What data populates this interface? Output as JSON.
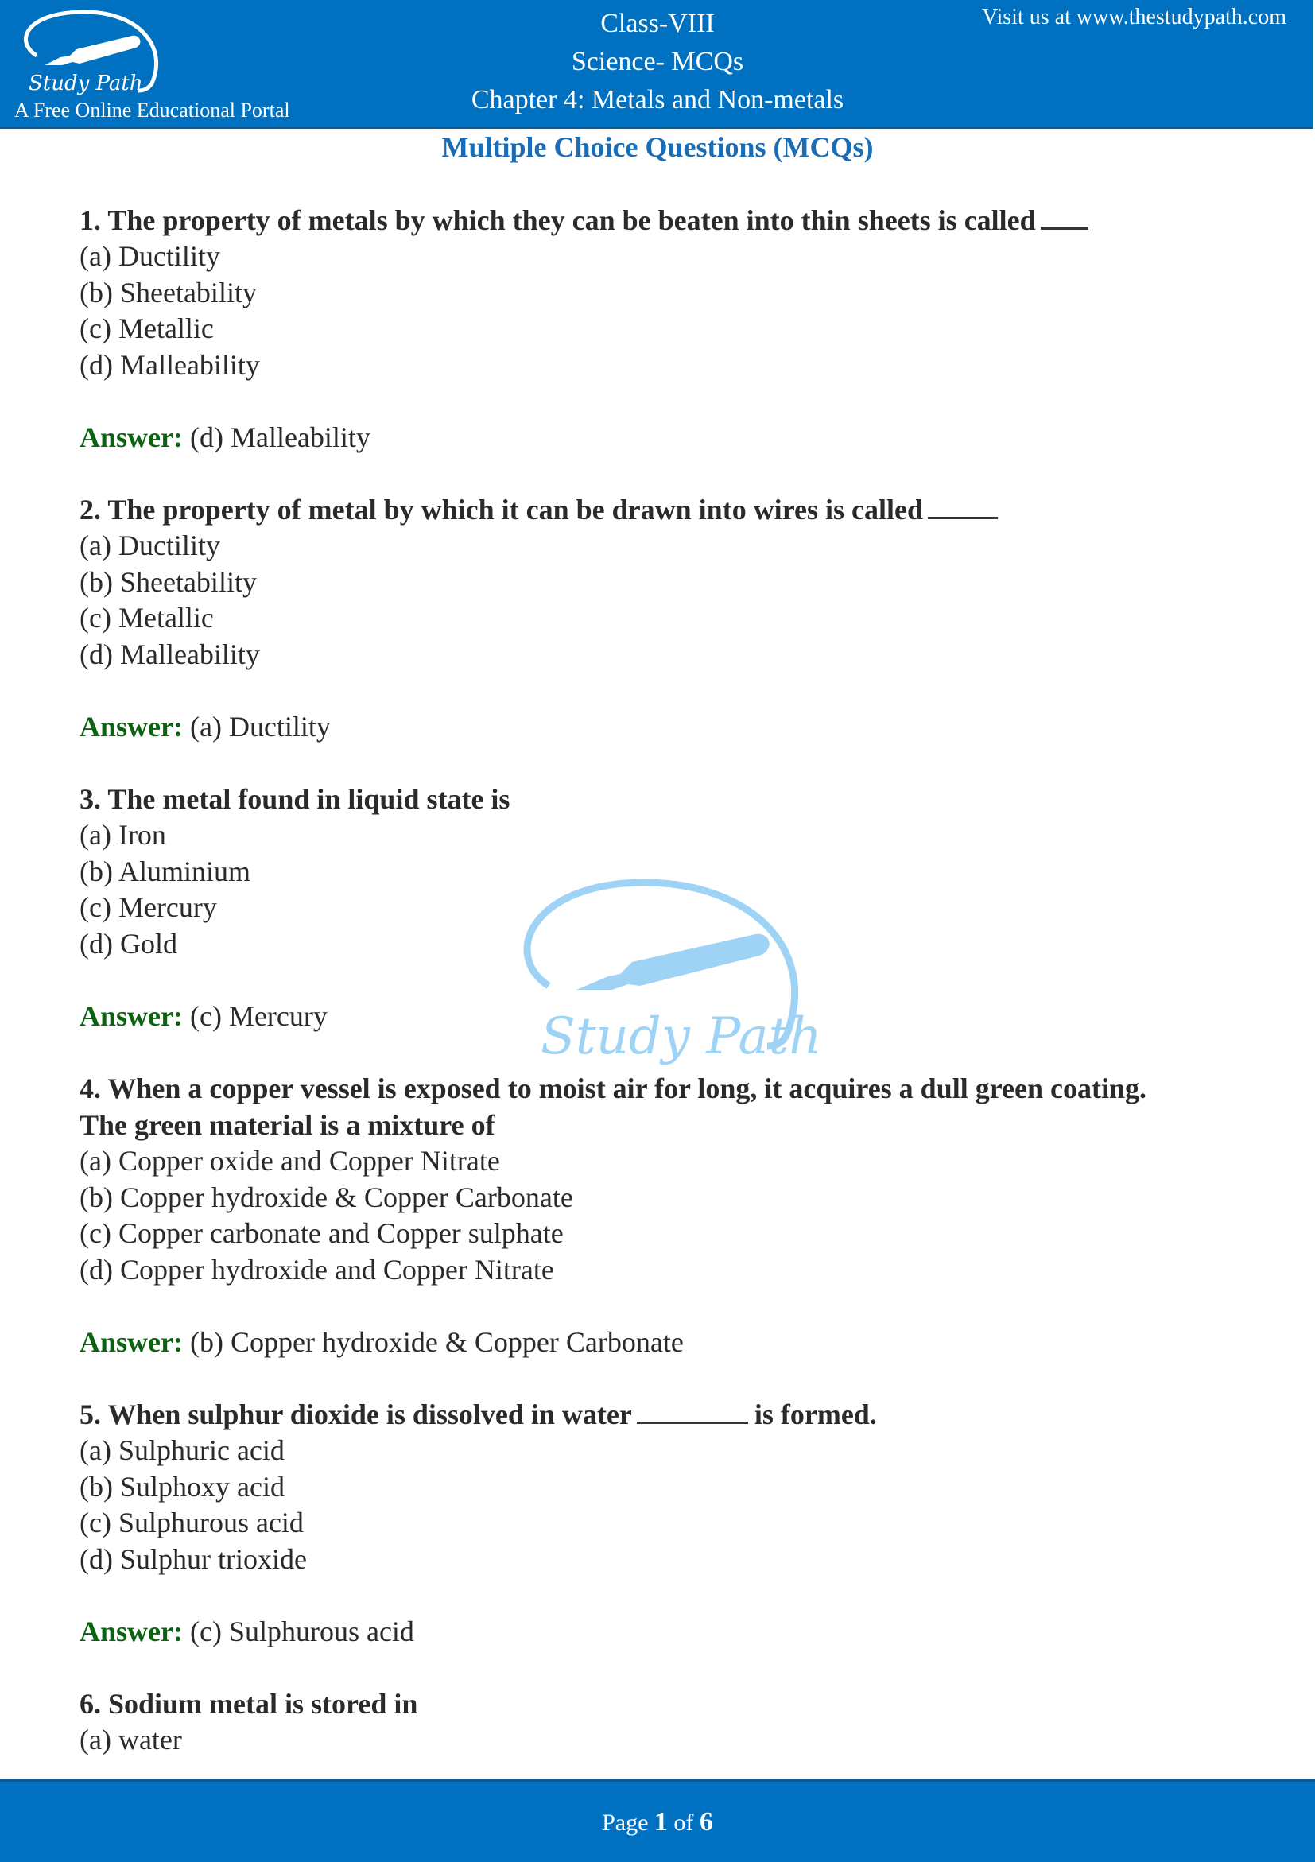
{
  "header": {
    "logo_text": "Study Path",
    "portal_tagline": "A Free Online Educational Portal",
    "class": "Class-VIII",
    "subject": "Science- MCQs",
    "chapter": "Chapter 4: Metals and Non-metals",
    "visit": "Visit us at www.thestudypath.com",
    "colors": {
      "banner": "#0070c0",
      "title": "#1a6cb4",
      "answer_label": "#0b6312",
      "watermark": "#9fd3f5"
    }
  },
  "page_title": "Multiple Choice Questions (MCQs)",
  "answer_label": "Answer:",
  "watermark_text": "Study Path",
  "questions": [
    {
      "question": "1. The property of metals by which they can be beaten into thin sheets is called",
      "options": [
        "(a) Ductility",
        "(b) Sheetability",
        "(c) Metallic",
        "(d) Malleability"
      ],
      "answer": "(d) Malleability"
    },
    {
      "question": "2. The property of metal by which it can be drawn into wires is called",
      "options": [
        "(a) Ductility",
        "(b) Sheetability",
        "(c) Metallic",
        "(d) Malleability"
      ],
      "answer": "(a) Ductility"
    },
    {
      "question": "3. The metal found in liquid state is",
      "options": [
        "(a) Iron",
        "(b) Aluminium",
        "(c) Mercury",
        "(d) Gold"
      ],
      "answer": "(c) Mercury"
    },
    {
      "question_line1": "4. When a copper vessel is exposed to moist air for long, it acquires a dull green coating.",
      "question_line2": "The green material is a mixture of",
      "options": [
        "(a) Copper oxide and Copper Nitrate",
        "(b) Copper hydroxide & Copper Carbonate",
        "(c) Copper carbonate and Copper sulphate",
        "(d) Copper hydroxide and Copper Nitrate"
      ],
      "answer": "(b) Copper hydroxide & Copper Carbonate"
    },
    {
      "question_part1": "5. When sulphur dioxide is dissolved in water",
      "question_part2": "is formed.",
      "options": [
        "(a) Sulphuric acid",
        "(b) Sulphoxy acid",
        "(c) Sulphurous acid",
        "(d) Sulphur trioxide"
      ],
      "answer": "(c) Sulphurous acid"
    },
    {
      "question": "6. Sodium metal is stored in",
      "options": [
        "(a) water"
      ]
    }
  ],
  "footer": {
    "page_word": "Page",
    "current": "1",
    "of_word": "of",
    "total": "6"
  }
}
